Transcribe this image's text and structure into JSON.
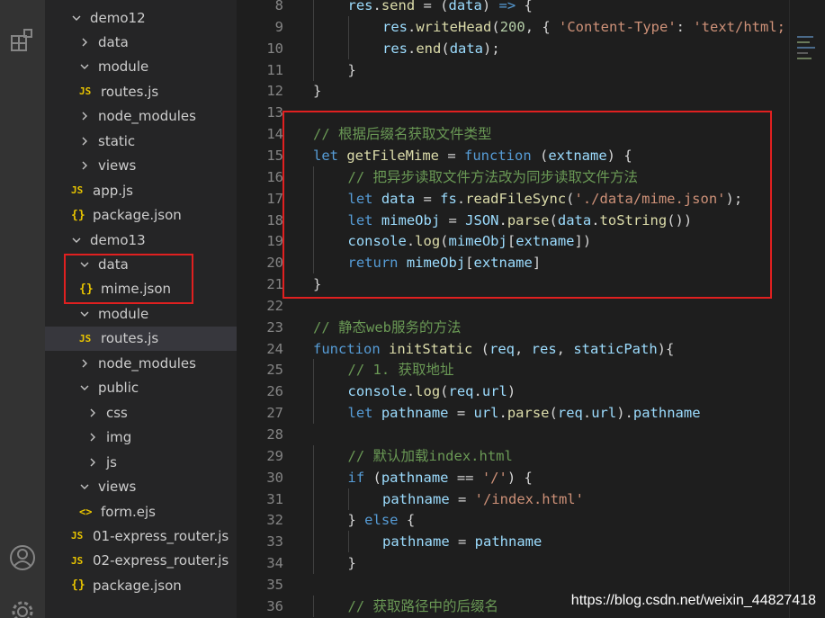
{
  "explorer": {
    "items": [
      {
        "label": "demo12",
        "kind": "folder-open"
      },
      {
        "label": "data",
        "kind": "folder-closed"
      },
      {
        "label": "module",
        "kind": "folder-open"
      },
      {
        "label": "routes.js",
        "kind": "js"
      },
      {
        "label": "node_modules",
        "kind": "folder-closed"
      },
      {
        "label": "static",
        "kind": "folder-closed"
      },
      {
        "label": "views",
        "kind": "folder-closed"
      },
      {
        "label": "app.js",
        "kind": "js"
      },
      {
        "label": "package.json",
        "kind": "json"
      },
      {
        "label": "demo13",
        "kind": "folder-open"
      },
      {
        "label": "data",
        "kind": "folder-open"
      },
      {
        "label": "mime.json",
        "kind": "json"
      },
      {
        "label": "module",
        "kind": "folder-open"
      },
      {
        "label": "routes.js",
        "kind": "js",
        "selected": true
      },
      {
        "label": "node_modules",
        "kind": "folder-closed"
      },
      {
        "label": "public",
        "kind": "folder-open"
      },
      {
        "label": "css",
        "kind": "folder-closed"
      },
      {
        "label": "img",
        "kind": "folder-closed"
      },
      {
        "label": "js",
        "kind": "folder-closed"
      },
      {
        "label": "views",
        "kind": "folder-open"
      },
      {
        "label": "form.ejs",
        "kind": "ejs"
      },
      {
        "label": "01-express_router.js",
        "kind": "js"
      },
      {
        "label": "02-express_router.js",
        "kind": "js"
      },
      {
        "label": "package.json",
        "kind": "json"
      }
    ],
    "icon_labels": {
      "js": "JS",
      "json": "{}",
      "ejs": "<>"
    }
  },
  "activity_bar": {
    "icons": [
      "extensions-icon",
      "account-icon",
      "settings-gear-icon"
    ]
  },
  "editor": {
    "lines": [
      {
        "num": "8",
        "indent": 1,
        "tokens": [
          [
            "v",
            "res"
          ],
          [
            "p",
            "."
          ],
          [
            "f",
            "send"
          ],
          [
            "p",
            " = ("
          ],
          [
            "v",
            "data"
          ],
          [
            "p",
            ") "
          ],
          [
            "k",
            "=>"
          ],
          [
            "p",
            " {"
          ]
        ]
      },
      {
        "num": "9",
        "indent": 2,
        "tokens": [
          [
            "v",
            "res"
          ],
          [
            "p",
            "."
          ],
          [
            "f",
            "writeHead"
          ],
          [
            "p",
            "("
          ],
          [
            "n",
            "200"
          ],
          [
            "p",
            ", { "
          ],
          [
            "s",
            "'Content-Type'"
          ],
          [
            "p",
            ": "
          ],
          [
            "s",
            "'text/html;"
          ]
        ]
      },
      {
        "num": "10",
        "indent": 2,
        "tokens": [
          [
            "v",
            "res"
          ],
          [
            "p",
            "."
          ],
          [
            "f",
            "end"
          ],
          [
            "p",
            "("
          ],
          [
            "v",
            "data"
          ],
          [
            "p",
            ");"
          ]
        ]
      },
      {
        "num": "11",
        "indent": 1,
        "tokens": [
          [
            "p",
            "}"
          ]
        ]
      },
      {
        "num": "12",
        "indent": 0,
        "tokens": [
          [
            "p",
            "}"
          ]
        ]
      },
      {
        "num": "13",
        "indent": 0,
        "tokens": []
      },
      {
        "num": "14",
        "indent": 0,
        "tokens": [
          [
            "c",
            "// 根据后缀名获取文件类型"
          ]
        ]
      },
      {
        "num": "15",
        "indent": 0,
        "tokens": [
          [
            "k",
            "let"
          ],
          [
            "p",
            " "
          ],
          [
            "f",
            "getFileMime"
          ],
          [
            "p",
            " = "
          ],
          [
            "k",
            "function"
          ],
          [
            "p",
            " ("
          ],
          [
            "v",
            "extname"
          ],
          [
            "p",
            ") {"
          ]
        ]
      },
      {
        "num": "16",
        "indent": 1,
        "tokens": [
          [
            "c",
            "// 把异步读取文件方法改为同步读取文件方法"
          ]
        ]
      },
      {
        "num": "17",
        "indent": 1,
        "tokens": [
          [
            "k",
            "let"
          ],
          [
            "p",
            " "
          ],
          [
            "v",
            "data"
          ],
          [
            "p",
            " = "
          ],
          [
            "v",
            "fs"
          ],
          [
            "p",
            "."
          ],
          [
            "f",
            "readFileSync"
          ],
          [
            "p",
            "("
          ],
          [
            "s",
            "'./data/mime.json'"
          ],
          [
            "p",
            ");"
          ]
        ]
      },
      {
        "num": "18",
        "indent": 1,
        "tokens": [
          [
            "k",
            "let"
          ],
          [
            "p",
            " "
          ],
          [
            "v",
            "mimeObj"
          ],
          [
            "p",
            " = "
          ],
          [
            "v",
            "JSON"
          ],
          [
            "p",
            "."
          ],
          [
            "f",
            "parse"
          ],
          [
            "p",
            "("
          ],
          [
            "v",
            "data"
          ],
          [
            "p",
            "."
          ],
          [
            "f",
            "toString"
          ],
          [
            "p",
            "())"
          ]
        ]
      },
      {
        "num": "19",
        "indent": 1,
        "tokens": [
          [
            "v",
            "console"
          ],
          [
            "p",
            "."
          ],
          [
            "f",
            "log"
          ],
          [
            "p",
            "("
          ],
          [
            "v",
            "mimeObj"
          ],
          [
            "p",
            "["
          ],
          [
            "v",
            "extname"
          ],
          [
            "p",
            "])"
          ]
        ]
      },
      {
        "num": "20",
        "indent": 1,
        "tokens": [
          [
            "k",
            "return"
          ],
          [
            "p",
            " "
          ],
          [
            "v",
            "mimeObj"
          ],
          [
            "p",
            "["
          ],
          [
            "v",
            "extname"
          ],
          [
            "p",
            "]"
          ]
        ]
      },
      {
        "num": "21",
        "indent": 0,
        "tokens": [
          [
            "p",
            "}"
          ]
        ]
      },
      {
        "num": "22",
        "indent": 0,
        "tokens": []
      },
      {
        "num": "23",
        "indent": 0,
        "tokens": [
          [
            "c",
            "// 静态web服务的方法"
          ]
        ]
      },
      {
        "num": "24",
        "indent": 0,
        "tokens": [
          [
            "k",
            "function"
          ],
          [
            "p",
            " "
          ],
          [
            "f",
            "initStatic"
          ],
          [
            "p",
            " ("
          ],
          [
            "v",
            "req"
          ],
          [
            "p",
            ", "
          ],
          [
            "v",
            "res"
          ],
          [
            "p",
            ", "
          ],
          [
            "v",
            "staticPath"
          ],
          [
            "p",
            "){"
          ]
        ]
      },
      {
        "num": "25",
        "indent": 1,
        "tokens": [
          [
            "c",
            "// 1. 获取地址"
          ]
        ]
      },
      {
        "num": "26",
        "indent": 1,
        "tokens": [
          [
            "v",
            "console"
          ],
          [
            "p",
            "."
          ],
          [
            "f",
            "log"
          ],
          [
            "p",
            "("
          ],
          [
            "v",
            "req"
          ],
          [
            "p",
            "."
          ],
          [
            "v",
            "url"
          ],
          [
            "p",
            ")"
          ]
        ]
      },
      {
        "num": "27",
        "indent": 1,
        "tokens": [
          [
            "k",
            "let"
          ],
          [
            "p",
            " "
          ],
          [
            "v",
            "pathname"
          ],
          [
            "p",
            " = "
          ],
          [
            "v",
            "url"
          ],
          [
            "p",
            "."
          ],
          [
            "f",
            "parse"
          ],
          [
            "p",
            "("
          ],
          [
            "v",
            "req"
          ],
          [
            "p",
            "."
          ],
          [
            "v",
            "url"
          ],
          [
            "p",
            ")."
          ],
          [
            "v",
            "pathname"
          ]
        ]
      },
      {
        "num": "28",
        "indent": 0,
        "tokens": []
      },
      {
        "num": "29",
        "indent": 1,
        "tokens": [
          [
            "c",
            "// 默认加载index.html"
          ]
        ]
      },
      {
        "num": "30",
        "indent": 1,
        "tokens": [
          [
            "k",
            "if"
          ],
          [
            "p",
            " ("
          ],
          [
            "v",
            "pathname"
          ],
          [
            "p",
            " == "
          ],
          [
            "s",
            "'/'"
          ],
          [
            "p",
            ") {"
          ]
        ]
      },
      {
        "num": "31",
        "indent": 2,
        "tokens": [
          [
            "v",
            "pathname"
          ],
          [
            "p",
            " = "
          ],
          [
            "s",
            "'/index.html'"
          ]
        ]
      },
      {
        "num": "32",
        "indent": 1,
        "tokens": [
          [
            "p",
            "} "
          ],
          [
            "k",
            "else"
          ],
          [
            "p",
            " {"
          ]
        ]
      },
      {
        "num": "33",
        "indent": 2,
        "tokens": [
          [
            "v",
            "pathname"
          ],
          [
            "p",
            " = "
          ],
          [
            "v",
            "pathname"
          ]
        ]
      },
      {
        "num": "34",
        "indent": 1,
        "tokens": [
          [
            "p",
            "}"
          ]
        ]
      },
      {
        "num": "35",
        "indent": 0,
        "tokens": []
      },
      {
        "num": "36",
        "indent": 1,
        "tokens": [
          [
            "c",
            "// 获取路径中的后缀名"
          ]
        ]
      }
    ]
  },
  "watermark": "https://blog.csdn.net/weixin_44827418",
  "colors": {
    "highlight_box": "#e02020",
    "keyword": "#569cd6",
    "function": "#dcdcaa",
    "variable": "#9cdcfe",
    "string": "#ce9178",
    "comment": "#6a9955",
    "number": "#b5cea8"
  }
}
